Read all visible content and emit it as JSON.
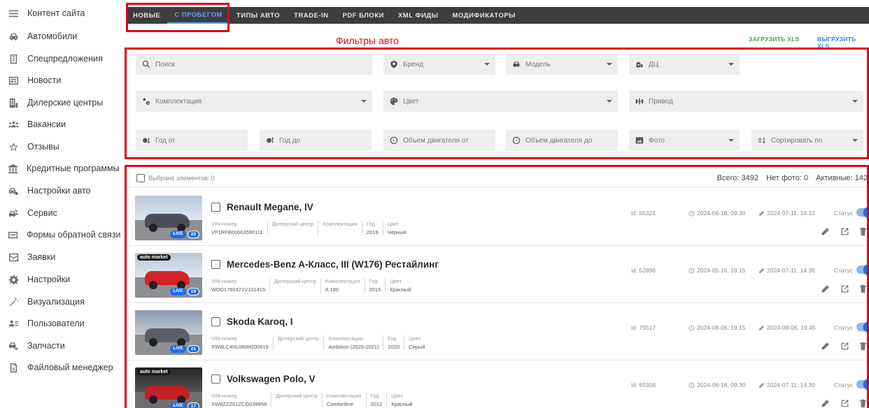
{
  "sidebar": {
    "items": [
      {
        "label": "Контент сайта",
        "icon": "menu-icon"
      },
      {
        "label": "Автомобили",
        "icon": "car-icon"
      },
      {
        "label": "Спецпредложения",
        "icon": "document-icon"
      },
      {
        "label": "Новости",
        "icon": "newspaper-icon"
      },
      {
        "label": "Дилерские центры",
        "icon": "building-icon"
      },
      {
        "label": "Вакансии",
        "icon": "people-icon"
      },
      {
        "label": "Отзывы",
        "icon": "star-icon"
      },
      {
        "label": "Кредитные программы",
        "icon": "bank-icon"
      },
      {
        "label": "Настройки авто",
        "icon": "car-settings-icon"
      },
      {
        "label": "Сервис",
        "icon": "car-service-icon"
      },
      {
        "label": "Формы обратной связи",
        "icon": "form-icon"
      },
      {
        "label": "Заявки",
        "icon": "mail-icon"
      },
      {
        "label": "Настройки",
        "icon": "gear-icon"
      },
      {
        "label": "Визуализация",
        "icon": "wand-icon"
      },
      {
        "label": "Пользователи",
        "icon": "users-icon"
      },
      {
        "label": "Запчасти",
        "icon": "parts-icon"
      },
      {
        "label": "Файловый менеджер",
        "icon": "file-icon"
      }
    ]
  },
  "tabs": [
    {
      "label": "НОВЫЕ"
    },
    {
      "label": "С ПРОБЕГОМ"
    },
    {
      "label": "ТИПЫ АВТО"
    },
    {
      "label": "TRADE-IN"
    },
    {
      "label": "PDF БЛОКИ"
    },
    {
      "label": "XML ФИДЫ"
    },
    {
      "label": "МОДИФИКАТОРЫ"
    }
  ],
  "active_tab": "С ПРОБЕГОМ",
  "filters": {
    "title": "Фильтры авто",
    "load_xls": "ЗАГРУЗИТЬ XLS",
    "unload_xls": "ВЫГРУЗИТЬ XLS",
    "search": "Поиск",
    "brand": "Бренд",
    "model": "Модель",
    "dc": "ДЦ",
    "trim": "Комплектация",
    "color": "Цвет",
    "drive": "Привод",
    "year_from": "Год от",
    "year_to": "Год до",
    "engine_from": "Объем двигателя от",
    "engine_to": "Объем двигателя до",
    "photo": "Фото",
    "sort": "Сортировать по"
  },
  "list": {
    "selected_label": "Выбрано элементов: 0",
    "total": "Всего: 3492",
    "no_photo": "Нет фото: 0",
    "active": "Активные: 142",
    "attr_labels": {
      "vin": "VIN-номер",
      "dealer": "Дилерский центр",
      "trim": "Комплектация",
      "year": "Год",
      "color": "Цвет"
    },
    "status_label": "Статус",
    "live_badge": "LIVE",
    "rows": [
      {
        "name": "Renault Megane, IV",
        "vin": "VF1RFB00663596111",
        "dealer": "",
        "trim": "",
        "year": "2019",
        "color": "Черный",
        "id": "id: 65321",
        "created": "2024-06-18, 09.30",
        "updated": "2024-07-11, 14.32",
        "photos": "20",
        "brand_tag": ""
      },
      {
        "name": "Mercedes-Benz A-Класс, III (W176) Рестайлинг",
        "vin": "WDD1760421V101415",
        "dealer": "",
        "trim": "A 180",
        "year": "2015",
        "color": "Красный",
        "id": "id: 52896",
        "created": "2024-05-16, 19.15",
        "updated": "2024-07-11, 14.30",
        "photos": "19",
        "brand_tag": "auto market"
      },
      {
        "name": "Skoda Karoq, I",
        "vin": "XW8LC4NU9MH200619",
        "dealer": "",
        "trim": "Ambition (2020-2021)",
        "year": "2020",
        "color": "Серый",
        "id": "id: 75517",
        "created": "2024-08-06, 19.15",
        "updated": "2024-08-06, 19.45",
        "photos": "21",
        "brand_tag": ""
      },
      {
        "name": "Volkswagen Polo, V",
        "vin": "XW8ZZZ61ZCG039958",
        "dealer": "",
        "trim": "Comfortline",
        "year": "2012",
        "color": "Красный",
        "id": "id: 65308",
        "created": "2024-06-18, 09.30",
        "updated": "2024-07-11, 14.30",
        "photos": "17",
        "brand_tag": "auto market"
      }
    ]
  },
  "colors": {
    "accent": "#1e6fe8",
    "highlight": "#e0001a",
    "tabbar": "#3d3d3d",
    "load": "#37a84a"
  }
}
